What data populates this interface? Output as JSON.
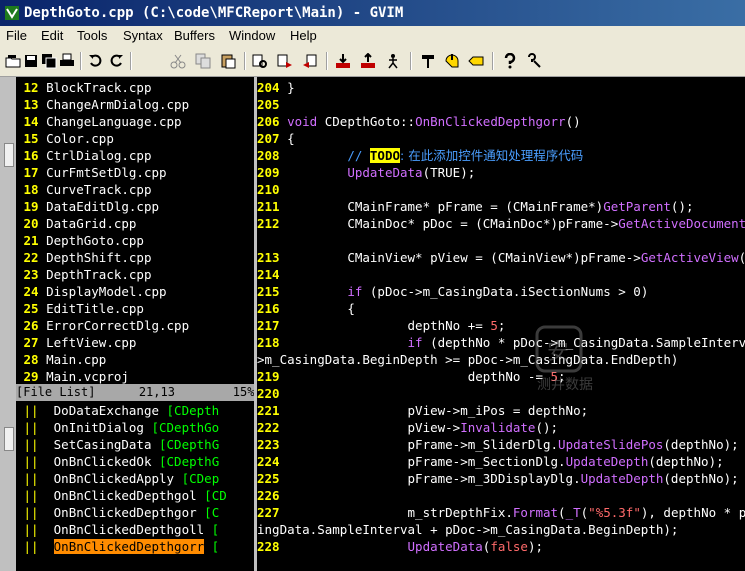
{
  "window": {
    "title": "DepthGoto.cpp (C:\\code\\MFCReport\\Main) - GVIM"
  },
  "menu": [
    "File",
    "Edit",
    "Tools",
    "Syntax",
    "Buffers",
    "Window",
    "Help"
  ],
  "file_list": {
    "rows": [
      {
        "n": "12",
        "name": "BlockTrack.cpp"
      },
      {
        "n": "13",
        "name": "ChangeArmDialog.cpp"
      },
      {
        "n": "14",
        "name": "ChangeLanguage.cpp"
      },
      {
        "n": "15",
        "name": "Color.cpp"
      },
      {
        "n": "16",
        "name": "CtrlDialog.cpp"
      },
      {
        "n": "17",
        "name": "CurFmtSetDlg.cpp"
      },
      {
        "n": "18",
        "name": "CurveTrack.cpp"
      },
      {
        "n": "19",
        "name": "DataEditDlg.cpp"
      },
      {
        "n": "20",
        "name": "DataGrid.cpp"
      },
      {
        "n": "21",
        "name": "DepthGoto.cpp"
      },
      {
        "n": "22",
        "name": "DepthShift.cpp"
      },
      {
        "n": "23",
        "name": "DepthTrack.cpp"
      },
      {
        "n": "24",
        "name": "DisplayModel.cpp"
      },
      {
        "n": "25",
        "name": "EditTitle.cpp"
      },
      {
        "n": "26",
        "name": "ErrorCorrectDlg.cpp"
      },
      {
        "n": "27",
        "name": "LeftView.cpp"
      },
      {
        "n": "28",
        "name": "Main.cpp"
      },
      {
        "n": "29",
        "name": "Main.vcproj"
      }
    ],
    "status": "[File List]      21,13        15%"
  },
  "tag_list": [
    {
      "name": "DoDataExchange",
      "ref": "[CDepth"
    },
    {
      "name": "OnInitDialog",
      "ref": "[CDepthGo"
    },
    {
      "name": "SetCasingData",
      "ref": "[CDepthG"
    },
    {
      "name": "OnBnClickedOk",
      "ref": "[CDepthG"
    },
    {
      "name": "OnBnClickedApply",
      "ref": "[CDep"
    },
    {
      "name": "OnBnClickedDepthgol",
      "ref": "[CD"
    },
    {
      "name": "OnBnClickedDepthgor",
      "ref": "[C"
    },
    {
      "name": "OnBnClickedDepthgoll",
      "ref": "["
    },
    {
      "name": "OnBnClickedDepthgorr",
      "ref": "["
    }
  ],
  "code": [
    {
      "n": "204",
      "parts": [
        [
          "plain",
          "}"
        ]
      ]
    },
    {
      "n": "205",
      "parts": []
    },
    {
      "n": "206",
      "parts": [
        [
          "kw",
          "void"
        ],
        [
          "plain",
          " CDepthGoto::"
        ],
        [
          "fn",
          "OnBnClickedDepthgorr"
        ],
        [
          "plain",
          "()"
        ]
      ]
    },
    {
      "n": "207",
      "parts": [
        [
          "plain",
          "{"
        ]
      ]
    },
    {
      "n": "208",
      "parts": [
        [
          "cm",
          "        // "
        ],
        [
          "todo",
          "TODO"
        ],
        [
          "cm",
          ": 在此添加控件通知处理程序代码"
        ]
      ]
    },
    {
      "n": "209",
      "parts": [
        [
          "fn",
          "        UpdateData"
        ],
        [
          "plain",
          "(TRUE);"
        ]
      ]
    },
    {
      "n": "210",
      "parts": []
    },
    {
      "n": "211",
      "parts": [
        [
          "plain",
          "        CMainFrame* pFrame = (CMainFrame*)"
        ],
        [
          "fn",
          "GetParent"
        ],
        [
          "plain",
          "();"
        ]
      ]
    },
    {
      "n": "212",
      "parts": [
        [
          "plain",
          "        CMainDoc* pDoc = (CMainDoc*)pFrame->"
        ],
        [
          "fn",
          "GetActiveDocument"
        ],
        [
          "plain",
          "();"
        ]
      ]
    },
    {
      "n": "",
      "parts": []
    },
    {
      "n": "213",
      "parts": [
        [
          "plain",
          "        CMainView* pView = (CMainView*)pFrame->"
        ],
        [
          "fn",
          "GetActiveView"
        ],
        [
          "plain",
          "();"
        ]
      ]
    },
    {
      "n": "214",
      "parts": []
    },
    {
      "n": "215",
      "parts": [
        [
          "kw",
          "        if"
        ],
        [
          "plain",
          " (pDoc->m_CasingData.iSectionNums > 0)"
        ]
      ]
    },
    {
      "n": "216",
      "parts": [
        [
          "plain",
          "        {"
        ]
      ]
    },
    {
      "n": "217",
      "parts": [
        [
          "plain",
          "                depthNo += "
        ],
        [
          "num",
          "5"
        ],
        [
          "plain",
          ";"
        ]
      ]
    },
    {
      "n": "218",
      "parts": [
        [
          "kw",
          "                if"
        ],
        [
          "plain",
          " (depthNo * pDoc->m_CasingData.SampleInterval"
        ]
      ]
    },
    {
      "n": "",
      "parts": [
        [
          "plain",
          ">m_CasingData.BeginDepth >= pDoc->m_CasingData.EndDepth)"
        ]
      ]
    },
    {
      "n": "219",
      "parts": [
        [
          "plain",
          "                        depthNo -= "
        ],
        [
          "num",
          "5"
        ],
        [
          "plain",
          ";"
        ]
      ]
    },
    {
      "n": "220",
      "parts": []
    },
    {
      "n": "221",
      "parts": [
        [
          "plain",
          "                pView->m_iPos = depthNo;"
        ]
      ]
    },
    {
      "n": "222",
      "parts": [
        [
          "plain",
          "                pView->"
        ],
        [
          "fn",
          "Invalidate"
        ],
        [
          "plain",
          "();"
        ]
      ]
    },
    {
      "n": "223",
      "parts": [
        [
          "plain",
          "                pFrame->m_SliderDlg."
        ],
        [
          "fn",
          "UpdateSlidePos"
        ],
        [
          "plain",
          "(depthNo);"
        ]
      ]
    },
    {
      "n": "224",
      "parts": [
        [
          "plain",
          "                pFrame->m_SectionDlg."
        ],
        [
          "fn",
          "UpdateDepth"
        ],
        [
          "plain",
          "(depthNo);"
        ]
      ]
    },
    {
      "n": "225",
      "parts": [
        [
          "plain",
          "                pFrame->m_3DDisplayDlg."
        ],
        [
          "fn",
          "UpdateDepth"
        ],
        [
          "plain",
          "(depthNo);"
        ]
      ]
    },
    {
      "n": "226",
      "parts": []
    },
    {
      "n": "227",
      "parts": [
        [
          "plain",
          "                m_strDepthFix."
        ],
        [
          "fn",
          "Format"
        ],
        [
          "plain",
          "("
        ],
        [
          "fn",
          "_T"
        ],
        [
          "plain",
          "("
        ],
        [
          "cn",
          "\"%5.3f\""
        ],
        [
          "plain",
          "), depthNo * pDoc"
        ]
      ]
    },
    {
      "n": "",
      "parts": [
        [
          "plain",
          "ingData.SampleInterval + pDoc->m_CasingData.BeginDepth);"
        ]
      ]
    },
    {
      "n": "228",
      "parts": [
        [
          "fn",
          "                UpdateData"
        ],
        [
          "plain",
          "("
        ],
        [
          "cn",
          "false"
        ],
        [
          "plain",
          ");"
        ]
      ]
    }
  ],
  "watermark": "测井数据",
  "colors": {
    "title_gradient_start": "#0a246a",
    "title_gradient_end": "#3a6ea5",
    "selection": "#ff8c00",
    "line_numbers": "#ffff00",
    "keywords": "#d16fff",
    "comments": "#4a9eff",
    "strings": "#ff6a6a"
  }
}
